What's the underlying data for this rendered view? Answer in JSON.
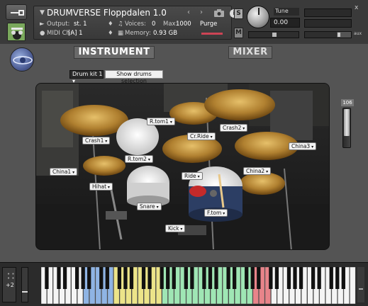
{
  "header": {
    "instrument_name": "DRUMVERSE Floppdalen 1.0",
    "output_label": "Output:",
    "output_value": "st. 1",
    "voices_label": "Voices:",
    "voices_value": "0",
    "max_label": "Max:",
    "max_value": "1000",
    "purge_label": "Purge",
    "midi_label": "MIDI Ch:",
    "midi_value": "[A]  1",
    "memory_label": "Memory:",
    "memory_value": "0.93 GB",
    "solo_label": "S",
    "mute_label": "M",
    "tune_label": "Tune",
    "tune_value": "0.00",
    "close_label": "x",
    "aux_label": "aux"
  },
  "tabs": {
    "instrument": "INSTRUMENT",
    "mixer": "MIXER"
  },
  "controls": {
    "kit_select": "Drum kit 1",
    "show_drums_button": "Show drums selection",
    "volume_value": "106"
  },
  "drum_pieces": [
    {
      "name": "crash1",
      "label": "Crash1"
    },
    {
      "name": "rtom1",
      "label": "R.tom1"
    },
    {
      "name": "cr-ride",
      "label": "Cr.Ride"
    },
    {
      "name": "crash2",
      "label": "Crash2"
    },
    {
      "name": "china3",
      "label": "China3"
    },
    {
      "name": "rtom2",
      "label": "R.tom2"
    },
    {
      "name": "china1",
      "label": "China1"
    },
    {
      "name": "ride",
      "label": "Ride"
    },
    {
      "name": "china2",
      "label": "China2"
    },
    {
      "name": "hihat",
      "label": "Hihat"
    },
    {
      "name": "snare",
      "label": "Snare"
    },
    {
      "name": "ftom",
      "label": "F.tom"
    },
    {
      "name": "kick",
      "label": "Kick"
    }
  ],
  "keyboard": {
    "octave_label": "+2",
    "colors": {
      "blue": "#8fb4e4",
      "yellow": "#ece489",
      "green": "#9fe6b4",
      "red": "#e8848a",
      "white": "#f4f4f4",
      "black": "#111111"
    }
  },
  "icons": [
    "wrench-icon",
    "camera-icon",
    "info-icon",
    "tune-knob",
    "logo"
  ]
}
